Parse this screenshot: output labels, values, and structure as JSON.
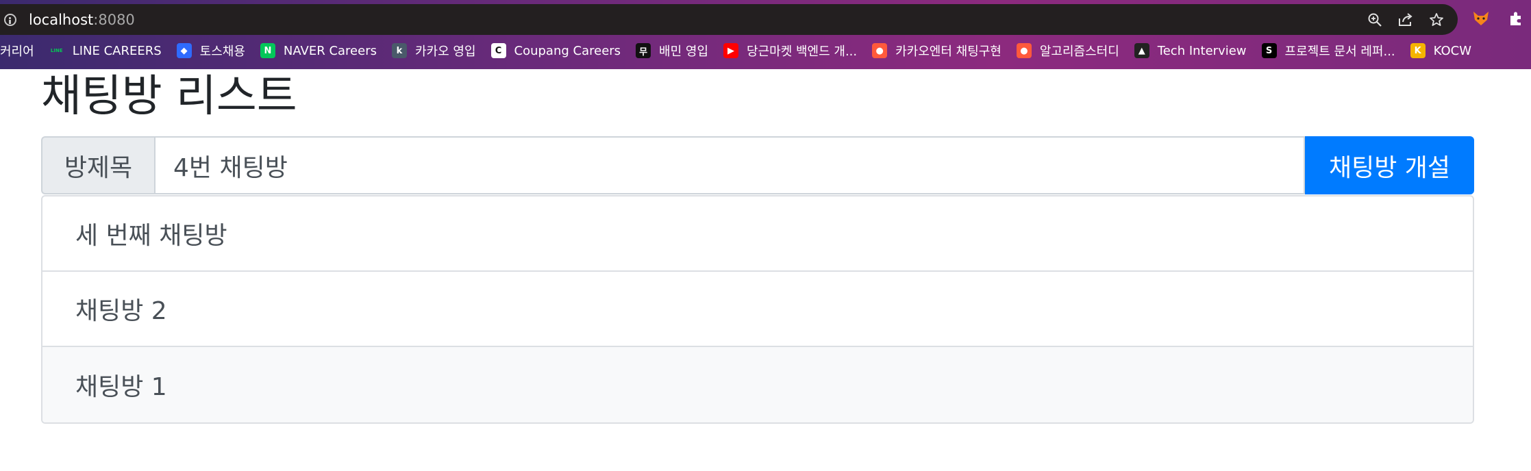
{
  "browser": {
    "address": {
      "host": "localhost",
      "port": ":8080"
    },
    "actions": [
      "zoom-icon",
      "share-icon",
      "star-icon"
    ],
    "extensions": [
      "fox-extension-icon",
      "puzzle-extensions-icon"
    ],
    "bookmarks": [
      {
        "label": "커리어",
        "icon": "",
        "color": ""
      },
      {
        "label": "LINE CAREERS",
        "icon": "LINE",
        "color": "#06c755"
      },
      {
        "label": "토스채용",
        "icon": "◆",
        "color": "#2f6bff"
      },
      {
        "label": "NAVER Careers",
        "icon": "N",
        "color": "#03c75a"
      },
      {
        "label": "카카오 영입",
        "icon": "k",
        "color": "#4a5a6a"
      },
      {
        "label": "Coupang Careers",
        "icon": "C",
        "color": "#ffffff"
      },
      {
        "label": "배민 영입",
        "icon": "무",
        "color": "#111111"
      },
      {
        "label": "당근마켓 백엔드 개...",
        "icon": "▶",
        "color": "#ff0000"
      },
      {
        "label": "카카오엔터 채팅구현",
        "icon": "●",
        "color": "#ff5a3c"
      },
      {
        "label": "알고리즘스터디",
        "icon": "●",
        "color": "#ff5a3c"
      },
      {
        "label": "Tech Interview",
        "icon": "▲",
        "color": "#222222"
      },
      {
        "label": "프로젝트 문서 레퍼...",
        "icon": "S",
        "color": "#000000"
      },
      {
        "label": "KOCW",
        "icon": "K",
        "color": "#f5b400"
      }
    ]
  },
  "page": {
    "title": "채팅방 리스트",
    "form": {
      "prepend_label": "방제목",
      "room_title_value": "4번 채팅방",
      "create_button_label": "채팅방 개설"
    },
    "rooms": [
      {
        "name": "세 번째 채팅방"
      },
      {
        "name": "채팅방 2"
      },
      {
        "name": "채팅방 1"
      }
    ]
  },
  "colors": {
    "primary": "#007bff",
    "prepend_bg": "#e9ecef",
    "border": "#ced4da",
    "text": "#495057",
    "hover_row_bg": "#f8f9fa"
  }
}
